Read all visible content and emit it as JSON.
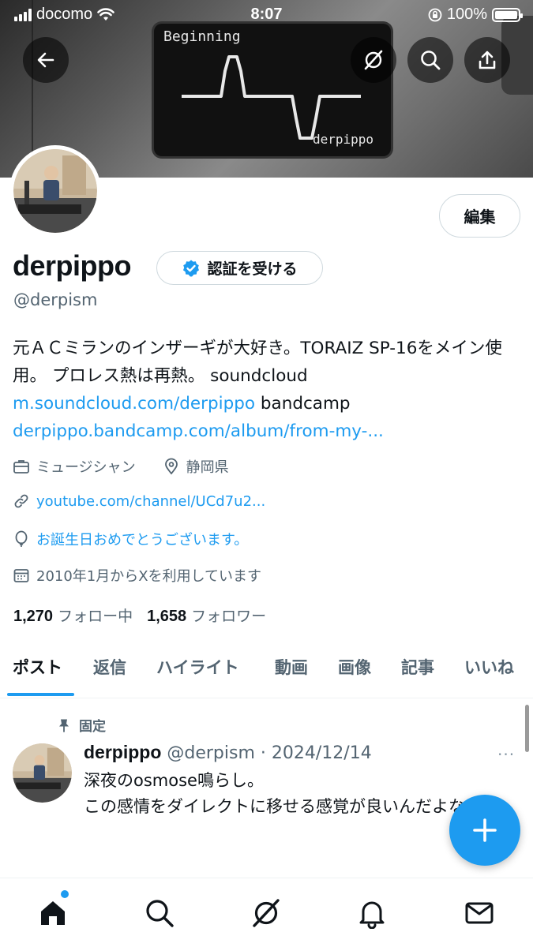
{
  "status_bar": {
    "carrier": "docomo",
    "time": "8:07",
    "battery": "100%"
  },
  "banner": {
    "screen_title": "Beginning",
    "screen_signature": "derpippo"
  },
  "header_buttons": {
    "back_icon": "arrow-left-icon",
    "grok_icon": "grok-icon",
    "search_icon": "search-icon",
    "share_icon": "share-icon"
  },
  "profile": {
    "edit_label": "編集",
    "name": "derpippo",
    "verify_label": "認証を受ける",
    "handle": "@derpism",
    "bio_text_1": "元ＡＣミランのインザーギが大好き。TORAIZ SP-16をメイン使用。 プロレス熱は再熱。 soundcloud",
    "bio_link_1": "m.soundcloud.com/derpippo",
    "bio_text_2": " bandcamp",
    "bio_link_2": "derpippo.bandcamp.com/album/from-my-...",
    "category": "ミュージシャン",
    "location": "静岡県",
    "website": "youtube.com/channel/UCd7u2...",
    "birthday": "お誕生日おめでとうございます。",
    "joined": "2010年1月からXを利用しています",
    "following_count": "1,270",
    "following_label": "フォロー中",
    "followers_count": "1,658",
    "followers_label": "フォロワー"
  },
  "tabs": [
    {
      "label": "ポスト"
    },
    {
      "label": "返信"
    },
    {
      "label": "ハイライト"
    },
    {
      "label": "動画"
    },
    {
      "label": "画像"
    },
    {
      "label": "記事"
    },
    {
      "label": "いいね"
    }
  ],
  "pinned_tweet": {
    "pinned_label": "固定",
    "author": "derpippo",
    "handle_date": "@derpism · 2024/12/14",
    "more": "···",
    "line1": "深夜のosmose鳴らし。",
    "line2": "この感情をダイレクトに移せる感覚が良いんだよなぁ。"
  },
  "colors": {
    "accent": "#1d9bf0",
    "text": "#0f1419",
    "muted": "#536471"
  },
  "bottom_nav": [
    "home-icon",
    "search-icon",
    "grok-icon",
    "bell-icon",
    "mail-icon"
  ]
}
